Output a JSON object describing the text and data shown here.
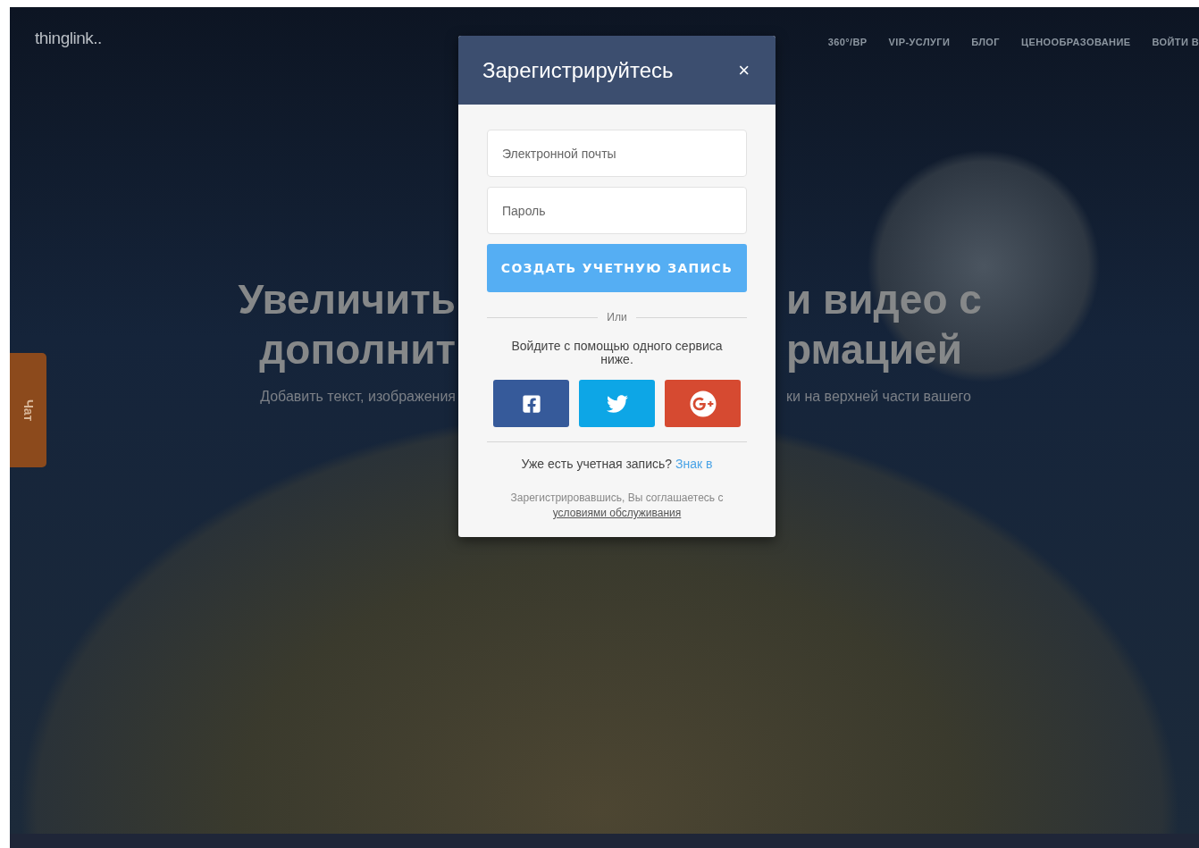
{
  "header": {
    "logo": "thinglink..",
    "nav": [
      "360°/ВР",
      "VIP-УСЛУГИ",
      "БЛОГ",
      "ЦЕНООБРАЗОВАНИЕ",
      "ВОЙТИ В"
    ]
  },
  "hero": {
    "headline_lines": [
      {
        "left": "Увеличить",
        "right": "и видео с"
      },
      {
        "left": "дополнит",
        "right": "рмацией"
      }
    ],
    "subtitle": {
      "left": "Добавить текст, изображения",
      "right": "ки на верхней части вашего"
    }
  },
  "chat_tab": {
    "label": "Чат"
  },
  "signup_modal": {
    "title": "Зарегистрируйтесь",
    "close": "×",
    "fields": [
      {
        "placeholder": "Электронной почты"
      },
      {
        "placeholder": "Пароль"
      }
    ],
    "submit": "СОЗДАТЬ УЧЕТНУЮ ЗАПИСЬ",
    "divider": "Или",
    "social_prompt": "Войдите с помощью одного сервиса ниже.",
    "social_buttons": [
      {
        "kind": "facebook",
        "color": "#365a9a"
      },
      {
        "kind": "twitter",
        "color": "#0da6e6"
      },
      {
        "kind": "google",
        "color": "#d64a31"
      }
    ],
    "signin_prompt": "Уже есть учетная запись?",
    "signin_link": "Знак в",
    "terms_text": "Зарегистрировавшись, Вы соглашаетесь с",
    "terms_link": "условиями обслуживания"
  }
}
